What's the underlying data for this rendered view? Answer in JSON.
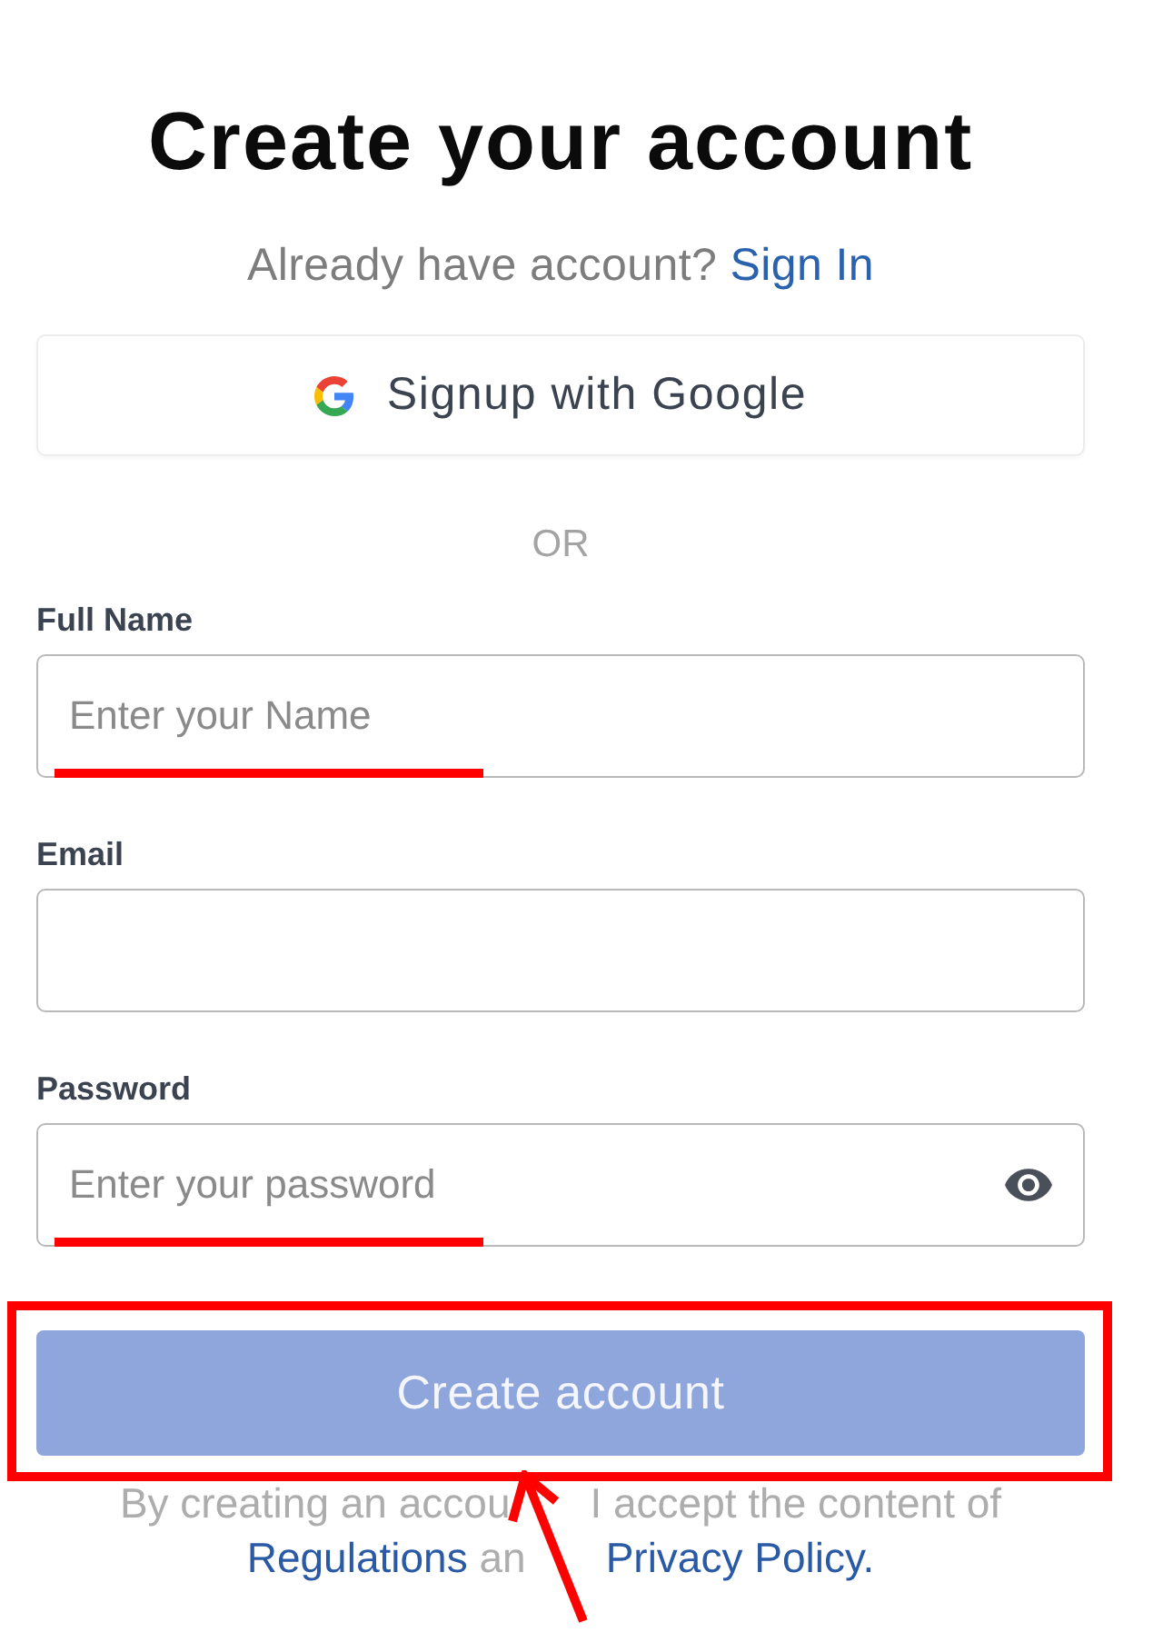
{
  "title": "Create your account",
  "signin_prompt": {
    "text": "Already have account?",
    "link": "Sign In"
  },
  "google_button": {
    "label": "Signup with Google"
  },
  "divider": {
    "label": "OR"
  },
  "fields": [
    {
      "label": "Full Name",
      "kind": "text",
      "placeholder": "Enter your Name",
      "underlined": true
    },
    {
      "label": "Email",
      "kind": "text",
      "underlined": false
    },
    {
      "label": "Password",
      "kind": "password",
      "placeholder": "Enter your password",
      "underlined": true
    }
  ],
  "submit_button": {
    "label": "Create account",
    "disabled": true,
    "framed": true,
    "pointed_at": true
  },
  "legal_note": {
    "lines": [
      [
        {
          "kind": "text",
          "text": "By creating an accou",
          "covered_after": true
        },
        {
          "kind": "text",
          "text": "I accept the content of",
          "covered_after": false
        }
      ],
      [
        {
          "kind": "link",
          "text": "Regulations",
          "covered_after": false
        },
        {
          "kind": "text",
          "text": "an",
          "covered_after": true
        },
        {
          "kind": "link",
          "text": "Privacy Policy.",
          "covered_after": false
        }
      ]
    ]
  }
}
